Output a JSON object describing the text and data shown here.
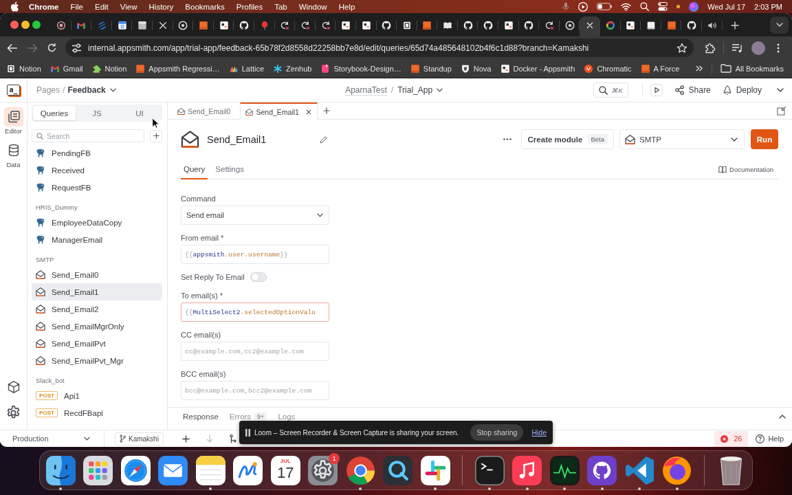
{
  "menubar": {
    "app_name": "Chrome",
    "menus": [
      "File",
      "Edit",
      "View",
      "History",
      "Bookmarks",
      "Profiles",
      "Tab",
      "Window",
      "Help"
    ],
    "date": "Wed Jul 17",
    "time": "2:03 PM"
  },
  "browser": {
    "tabs": [
      {
        "kind": "record",
        "selected": false
      },
      {
        "kind": "gmail",
        "selected": false
      },
      {
        "kind": "stripes",
        "selected": false
      },
      {
        "kind": "calendar",
        "selected": false
      },
      {
        "kind": "page",
        "selected": false
      },
      {
        "kind": "cross",
        "selected": false
      },
      {
        "kind": "chrome",
        "selected": false
      },
      {
        "kind": "orange",
        "selected": false
      },
      {
        "kind": "appsmith",
        "selected": false
      },
      {
        "kind": "github",
        "selected": false
      },
      {
        "kind": "balloon",
        "selected": false
      },
      {
        "kind": "error",
        "selected": false
      },
      {
        "kind": "error",
        "selected": false
      },
      {
        "kind": "error",
        "selected": false
      },
      {
        "kind": "appsmith",
        "selected": false
      },
      {
        "kind": "appsmith",
        "selected": false
      },
      {
        "kind": "github",
        "selected": false
      },
      {
        "kind": "notion",
        "selected": false
      },
      {
        "kind": "orange",
        "selected": false
      },
      {
        "kind": "book",
        "selected": false
      },
      {
        "kind": "github",
        "selected": false
      },
      {
        "kind": "github",
        "selected": false
      },
      {
        "kind": "appsmith",
        "selected": false
      },
      {
        "kind": "github",
        "selected": false
      },
      {
        "kind": "error",
        "selected": false
      },
      {
        "kind": "chrome",
        "selected": false
      },
      {
        "selected": true
      },
      {
        "kind": "google",
        "selected": false
      },
      {
        "kind": "appsmith",
        "selected": false
      },
      {
        "kind": "blank",
        "selected": false
      },
      {
        "kind": "orange",
        "selected": false
      },
      {
        "kind": "github",
        "selected": false
      },
      {
        "kind": "speaker",
        "selected": false
      }
    ],
    "back_enabled": true,
    "forward_enabled": false,
    "url": "internal.appsmith.com/app/trial-app/feedback-65b78f2d8558d22258bb7e8d/edit/queries/65d74a485648102b4f6c1d88?branch=Kamakshi",
    "bookmarks": [
      {
        "kind": "notion",
        "label": "Notion"
      },
      {
        "kind": "gmail",
        "label": "Gmail"
      },
      {
        "kind": "puzzle",
        "label": "Notion"
      },
      {
        "kind": "orange",
        "label": "Appsmith Regressi…"
      },
      {
        "kind": "lattice",
        "label": "Lattice"
      },
      {
        "kind": "zenhub",
        "label": "Zenhub"
      },
      {
        "kind": "storybook",
        "label": "Storybook-Design…"
      },
      {
        "kind": "orange",
        "label": "Standup"
      },
      {
        "kind": "nova",
        "label": "Nova"
      },
      {
        "kind": "appsmith",
        "label": "Docker - Appsmith"
      },
      {
        "kind": "chromatic",
        "label": "Chromatic"
      },
      {
        "kind": "orange",
        "label": "A Force"
      }
    ],
    "all_bookmarks": "All Bookmarks"
  },
  "app": {
    "logo": "a_",
    "breadcrumb": {
      "parent": "Pages",
      "separator": "/",
      "current": "Feedback"
    },
    "title": {
      "workspace": "AparnaTest",
      "separator": "/",
      "app": "Trial_App"
    },
    "search_shortcut": "⌘K",
    "share": "Share",
    "deploy": "Deploy",
    "rail": [
      {
        "kind": "editor",
        "label": "Editor",
        "selected": true
      },
      {
        "kind": "data",
        "label": "Data",
        "selected": false
      }
    ],
    "explorer": {
      "tabs": [
        {
          "label": "Queries",
          "selected": true
        },
        {
          "label": "JS",
          "selected": false
        },
        {
          "label": "UI",
          "selected": false
        }
      ],
      "search": {
        "placeholder": "Search"
      },
      "groups": [
        {
          "items": [
            {
              "kind": "postgres",
              "label": "PendingFB",
              "selected": false
            },
            {
              "kind": "postgres",
              "label": "Received",
              "selected": false
            },
            {
              "kind": "postgres",
              "label": "RequestFB",
              "selected": false
            }
          ]
        },
        {
          "name": "HRIS_Dummy",
          "items": [
            {
              "kind": "postgres",
              "label": "EmployeeDataCopy",
              "selected": false
            },
            {
              "kind": "postgres",
              "label": "ManagerEmail",
              "selected": false
            }
          ]
        },
        {
          "name": "SMTP",
          "items": [
            {
              "kind": "smtp",
              "label": "Send_Email0",
              "selected": false
            },
            {
              "kind": "smtp",
              "label": "Send_Email1",
              "selected": true
            },
            {
              "kind": "smtp",
              "label": "Send_Email2",
              "selected": false
            },
            {
              "kind": "smtp",
              "label": "Send_EmailMgrOnly",
              "selected": false
            },
            {
              "kind": "smtp",
              "label": "Send_EmailPvt",
              "selected": false
            },
            {
              "kind": "smtp",
              "label": "Send_EmailPvt_Mgr",
              "selected": false
            }
          ]
        },
        {
          "name": "Slack_bot",
          "items": [
            {
              "kind": "api",
              "method": "POST",
              "label": "Api1",
              "selected": false
            },
            {
              "kind": "api",
              "method": "POST",
              "label": "RecdFBapi",
              "selected": false
            }
          ]
        }
      ]
    },
    "editor_tabs": [
      {
        "label": "Send_Email0",
        "selected": false
      },
      {
        "label": "Send_Email1",
        "selected": true
      }
    ],
    "query": {
      "name": "Send_Email1",
      "create_module": "Create module",
      "beta": "Beta",
      "datasource": "SMTP",
      "run": "Run",
      "tabs": [
        {
          "label": "Query",
          "selected": true
        },
        {
          "label": "Settings",
          "selected": false
        }
      ],
      "documentation": "Documentation",
      "fields": [
        {
          "kind": "select",
          "label": "Command",
          "value": "Send email"
        },
        {
          "kind": "code",
          "label": "From email *",
          "error": false,
          "tokens": [
            {
              "kind": "brace",
              "text": "{{"
            },
            {
              "kind": "object",
              "text": "appsmith"
            },
            {
              "kind": "property",
              "text": ".user.username"
            },
            {
              "kind": "brace",
              "text": "}}"
            }
          ]
        },
        {
          "kind": "toggle",
          "label": "Set Reply To Email",
          "on": false
        },
        {
          "kind": "code",
          "label": "To email(s) *",
          "error": true,
          "tokens": [
            {
              "kind": "brace",
              "text": "{{"
            },
            {
              "kind": "object",
              "text": "MultiSelect2"
            },
            {
              "kind": "property",
              "text": ".selectedOptionValu"
            }
          ]
        },
        {
          "kind": "text",
          "label": "CC email(s)",
          "placeholder": "cc@example.com,cc2@example.com"
        },
        {
          "kind": "text",
          "label": "BCC email(s)",
          "placeholder": "bcc@example.com,bcc2@example.com"
        }
      ]
    },
    "response_tabs": [
      {
        "label": "Response",
        "selected": true
      },
      {
        "label": "Errors",
        "count": "9+",
        "selected": false
      },
      {
        "label": "Logs",
        "selected": false
      }
    ],
    "bottom_bar": {
      "environment": "Production",
      "branch": "Kamakshi",
      "pull_enabled": false,
      "error_count": "26",
      "help": "Help"
    }
  },
  "loom": {
    "message": "Loom – Screen Recorder & Screen Capture is sharing your screen.",
    "stop": "Stop sharing",
    "hide": "Hide"
  },
  "dock": {
    "sections": [
      {
        "apps": [
          {
            "kind": "finder",
            "running": true
          },
          {
            "kind": "launchpad",
            "running": false
          },
          {
            "kind": "safari",
            "running": false
          },
          {
            "kind": "mail",
            "running": false
          },
          {
            "kind": "notes",
            "running": true
          },
          {
            "kind": "freeform",
            "running": false
          },
          {
            "kind": "calendar",
            "month": "JUL",
            "day": "17",
            "running": false
          },
          {
            "kind": "settings",
            "badge": "1",
            "running": false
          },
          {
            "kind": "chrome",
            "running": true
          },
          {
            "kind": "quicktime",
            "running": false
          },
          {
            "kind": "slack",
            "running": true
          }
        ]
      },
      {
        "apps": [
          {
            "kind": "terminal",
            "running": true
          },
          {
            "kind": "music",
            "running": true
          },
          {
            "kind": "activity",
            "running": true
          },
          {
            "kind": "githubdesktop",
            "running": true
          },
          {
            "kind": "vscode",
            "running": true
          },
          {
            "kind": "firefox",
            "running": true
          }
        ]
      },
      {
        "apps": [
          {
            "kind": "trash",
            "running": false
          }
        ]
      }
    ]
  }
}
